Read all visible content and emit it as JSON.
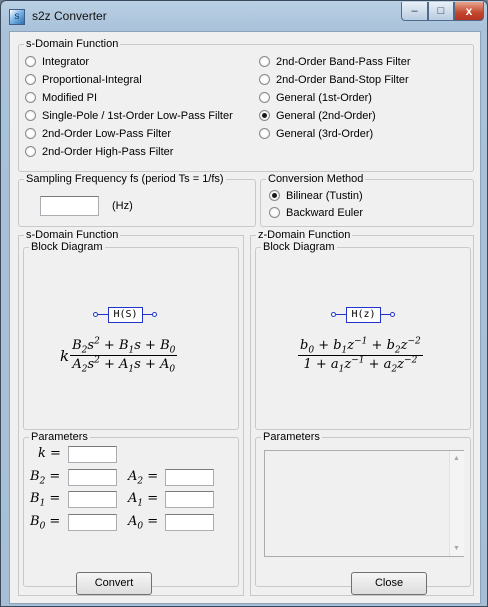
{
  "window": {
    "title": "s2z Converter",
    "app_icon": "s2z-app-icon",
    "buttons": {
      "minimize": "–",
      "maximize": "□",
      "close": "x"
    }
  },
  "s_domain_function": {
    "label": "s-Domain Function",
    "options_left": [
      {
        "label": "Integrator",
        "selected": false
      },
      {
        "label": "Proportional-Integral",
        "selected": false
      },
      {
        "label": "Modified PI",
        "selected": false
      },
      {
        "label": "Single-Pole / 1st-Order Low-Pass Filter",
        "selected": false
      },
      {
        "label": "2nd-Order Low-Pass Filter",
        "selected": false
      },
      {
        "label": "2nd-Order High-Pass Filter",
        "selected": false
      }
    ],
    "options_right": [
      {
        "label": "2nd-Order Band-Pass Filter",
        "selected": false
      },
      {
        "label": "2nd-Order Band-Stop Filter",
        "selected": false
      },
      {
        "label": "General (1st-Order)",
        "selected": false
      },
      {
        "label": "General (2nd-Order)",
        "selected": true
      },
      {
        "label": "General (3rd-Order)",
        "selected": false
      }
    ]
  },
  "sampling": {
    "label": "Sampling Frequency fs (period Ts = 1/fs)",
    "value": "",
    "unit": "(Hz)"
  },
  "conversion": {
    "label": "Conversion Method",
    "options": [
      {
        "label": "Bilinear (Tustin)",
        "selected": true
      },
      {
        "label": "Backward Euler",
        "selected": false
      }
    ]
  },
  "s_panel": {
    "label": "s-Domain Function",
    "block_diagram_label": "Block Diagram",
    "block_text": "H(S)",
    "parameters_label": "Parameters",
    "params": [
      {
        "sym": "k",
        "sub": "",
        "value": ""
      },
      {
        "sym": "B",
        "sub": "2",
        "value": ""
      },
      {
        "sym": "B",
        "sub": "1",
        "value": ""
      },
      {
        "sym": "B",
        "sub": "0",
        "value": ""
      },
      {
        "sym": "A",
        "sub": "2",
        "value": ""
      },
      {
        "sym": "A",
        "sub": "1",
        "value": ""
      },
      {
        "sym": "A",
        "sub": "0",
        "value": ""
      }
    ]
  },
  "z_panel": {
    "label": "z-Domain Function",
    "block_diagram_label": "Block Diagram",
    "block_text": "H(z)",
    "parameters_label": "Parameters",
    "parameters_text": ""
  },
  "buttons": {
    "convert": "Convert",
    "close": "Close"
  }
}
